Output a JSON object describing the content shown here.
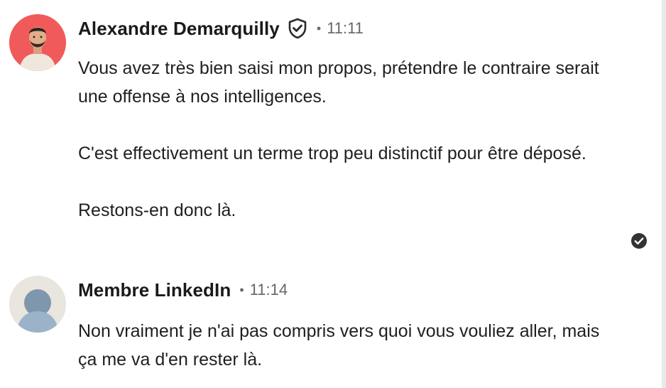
{
  "messages": [
    {
      "author": "Alexandre Demarquilly",
      "verified_icon": "shield-check-icon",
      "separator": "•",
      "time": "11:11",
      "paragraphs": [
        "Vous avez très bien saisi mon propos, prétendre le contraire serait une offense à nos intelligences.",
        "C'est effectivement un terme trop peu distinctif pour être déposé.",
        "Restons-en donc là."
      ],
      "status_icon": "check-circle-icon"
    },
    {
      "author": "Membre LinkedIn",
      "separator": "•",
      "time": "11:14",
      "paragraphs": [
        "Non vraiment je n'ai pas compris vers quoi vous vouliez aller, mais ça me va d'en rester là."
      ]
    }
  ],
  "colors": {
    "avatar_1_bg": "#f05a5a",
    "avatar_2_bg": "#e9e5df",
    "placeholder_person": "#8aa4bd",
    "text": "#1f1f1f",
    "muted": "#666666"
  }
}
